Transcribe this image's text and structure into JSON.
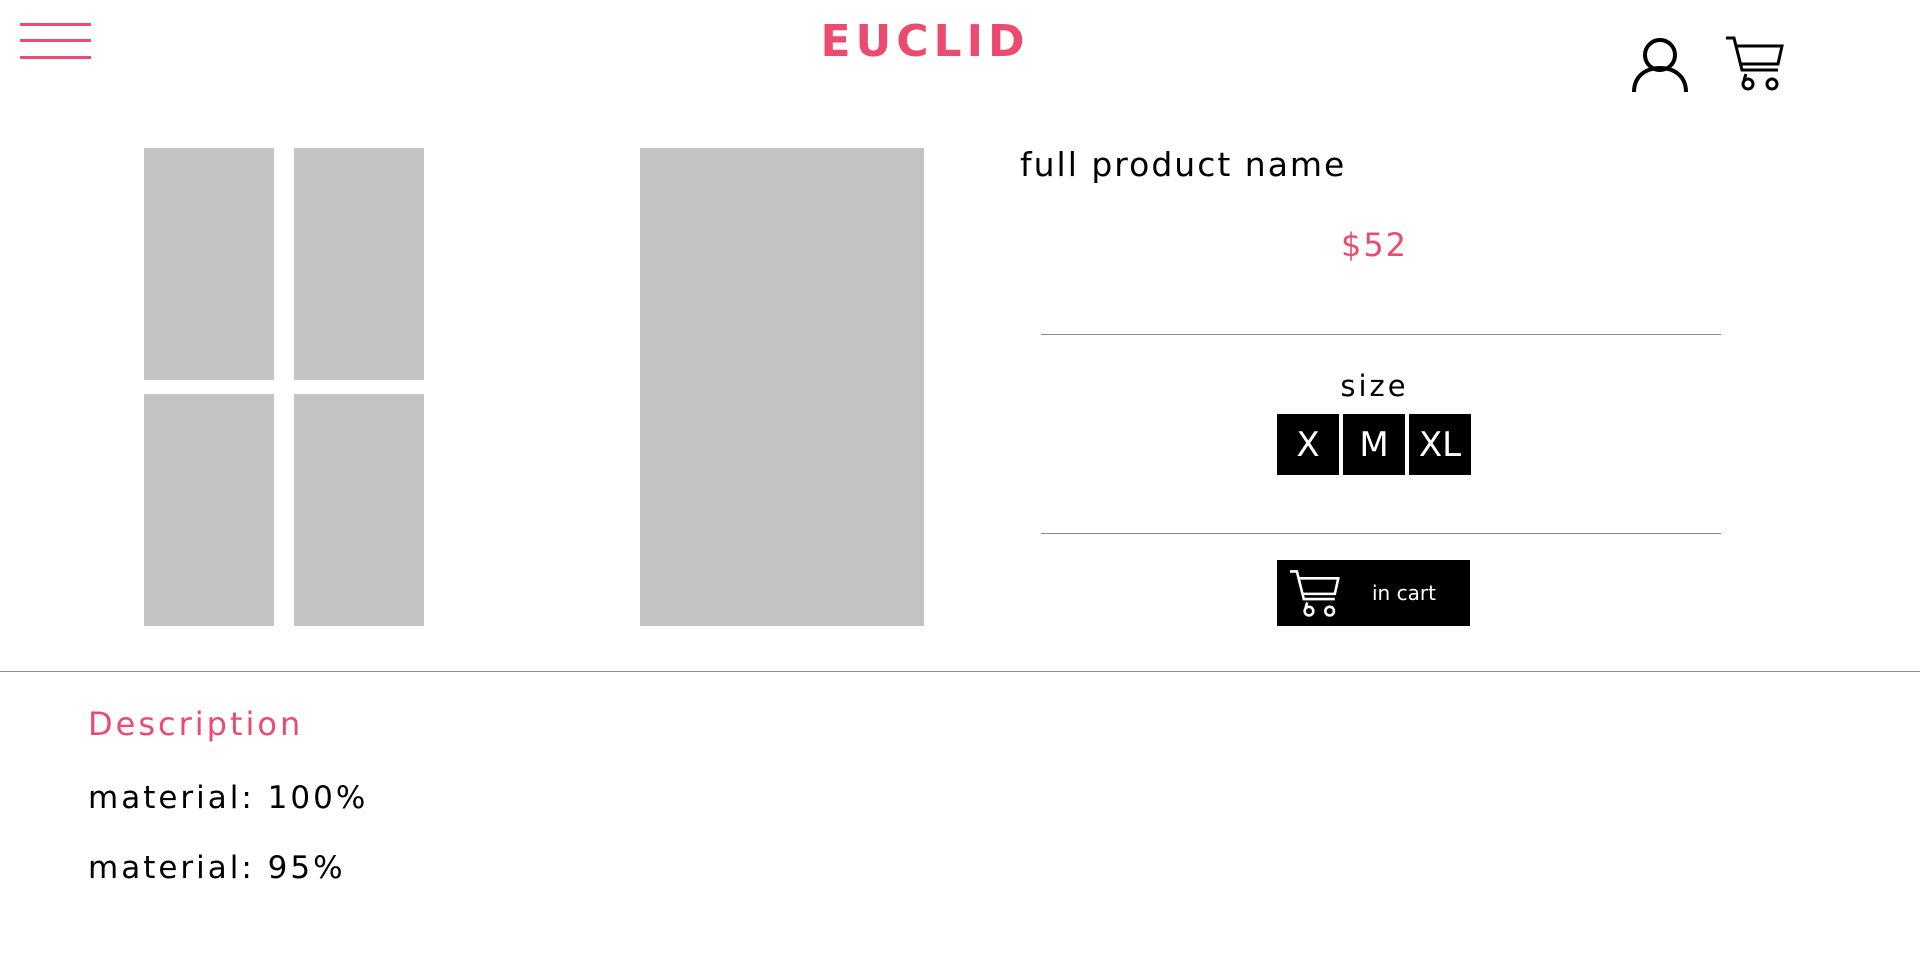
{
  "header": {
    "brand": "EUCLID",
    "menu_icon": "hamburger-menu-icon",
    "account_icon": "user-icon",
    "cart_icon": "shopping-cart-icon"
  },
  "product": {
    "name": "full product name",
    "price": "$52",
    "size_label": "size",
    "sizes": [
      "X",
      "M",
      "XL"
    ],
    "add_to_cart_label": "in cart"
  },
  "description": {
    "title": "Description",
    "lines": [
      "material: 100%",
      "material: 95%"
    ]
  },
  "colors": {
    "accent": "#ea4b6e",
    "placeholder": "#c4c4c4",
    "button": "#000000"
  }
}
